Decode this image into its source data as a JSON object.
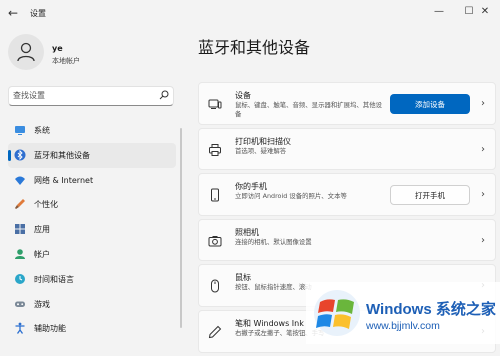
{
  "window": {
    "title": "设置",
    "back": "←",
    "minimize": "—",
    "maximize": "☐",
    "close": "✕"
  },
  "account": {
    "name": "ye",
    "type": "本地帐户"
  },
  "search": {
    "placeholder": "查找设置"
  },
  "nav": {
    "items": [
      {
        "label": "系统",
        "icon": "monitor-icon"
      },
      {
        "label": "蓝牙和其他设备",
        "icon": "bluetooth-icon",
        "active": true
      },
      {
        "label": "网络 & Internet",
        "icon": "wifi-icon"
      },
      {
        "label": "个性化",
        "icon": "brush-icon"
      },
      {
        "label": "应用",
        "icon": "apps-icon"
      },
      {
        "label": "帐户",
        "icon": "person-icon"
      },
      {
        "label": "时间和语言",
        "icon": "globe-clock-icon"
      },
      {
        "label": "游戏",
        "icon": "gamepad-icon"
      },
      {
        "label": "辅助功能",
        "icon": "accessibility-icon"
      }
    ]
  },
  "page": {
    "title": "蓝牙和其他设备"
  },
  "cards": [
    {
      "title": "设备",
      "subtitle": "鼠标、键盘、触笔、音频、显示器和扩展坞、其他设备",
      "button": "添加设备",
      "icon": "devices-icon"
    },
    {
      "title": "打印机和扫描仪",
      "subtitle": "首选项、疑难解答",
      "icon": "printer-icon"
    },
    {
      "title": "你的手机",
      "subtitle": "立即访问 Android 设备的照片、文本等",
      "button": "打开手机",
      "icon": "phone-icon"
    },
    {
      "title": "照相机",
      "subtitle": "连接的相机、默认图像设置",
      "icon": "camera-icon"
    },
    {
      "title": "鼠标",
      "subtitle": "按钮、鼠标指针速度、滚动",
      "icon": "mouse-icon"
    },
    {
      "title": "笔和 Windows Ink",
      "subtitle": "右撇子或左撇子、笔按钮、手写",
      "icon": "pen-icon"
    }
  ],
  "chevron": "›",
  "watermark": {
    "brand": "Windows",
    "brand_cn": "系统之家",
    "url": "www.bjjmlv.com"
  },
  "colors": {
    "accent": "#0067c0",
    "background": "#f3f3f3",
    "card": "#fbfbfb",
    "watermark_blue": "#1d5fb6"
  }
}
